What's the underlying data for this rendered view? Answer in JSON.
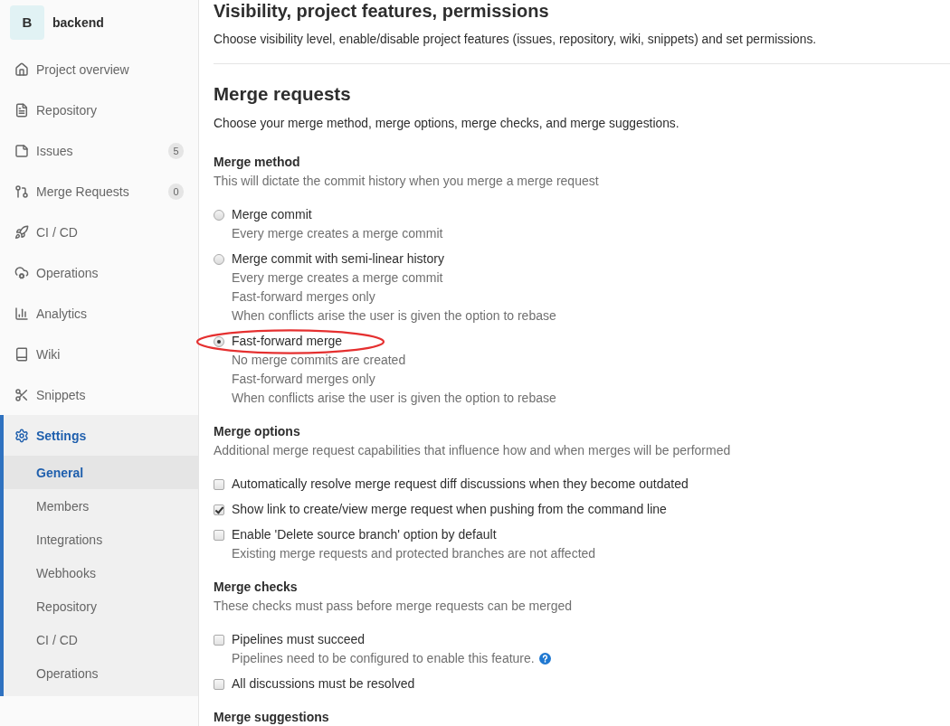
{
  "sidebar": {
    "project": {
      "avatar": "B",
      "name": "backend"
    },
    "items": [
      {
        "label": "Project overview",
        "selected": false
      },
      {
        "label": "Repository",
        "selected": false
      },
      {
        "label": "Issues",
        "badge": "5",
        "selected": false
      },
      {
        "label": "Merge Requests",
        "badge": "0",
        "selected": false
      },
      {
        "label": "CI / CD",
        "selected": false
      },
      {
        "label": "Operations",
        "selected": false
      },
      {
        "label": "Analytics",
        "selected": false
      },
      {
        "label": "Wiki",
        "selected": false
      },
      {
        "label": "Snippets",
        "selected": false
      },
      {
        "label": "Settings",
        "selected": true,
        "children": [
          {
            "label": "General",
            "selected": true
          },
          {
            "label": "Members",
            "selected": false
          },
          {
            "label": "Integrations",
            "selected": false
          },
          {
            "label": "Webhooks",
            "selected": false
          },
          {
            "label": "Repository",
            "selected": false
          },
          {
            "label": "CI / CD",
            "selected": false
          },
          {
            "label": "Operations",
            "selected": false
          }
        ]
      }
    ]
  },
  "page": {
    "visibility": {
      "title": "Visibility, project features, permissions",
      "description": "Choose visibility level, enable/disable project features (issues, repository, wiki, snippets) and set permissions."
    },
    "merge_requests": {
      "title": "Merge requests",
      "description": "Choose your merge method, merge options, merge checks, and merge suggestions.",
      "groups": [
        {
          "title": "Merge method",
          "description": "This will dictate the commit history when you merge a merge request",
          "options": [
            {
              "kind": "radio",
              "label": "Merge commit",
              "selected": false,
              "circled": false,
              "notes": [
                "Every merge creates a merge commit"
              ]
            },
            {
              "kind": "radio",
              "label": "Merge commit with semi-linear history",
              "selected": false,
              "circled": false,
              "notes": [
                "Every merge creates a merge commit",
                "Fast-forward merges only",
                "When conflicts arise the user is given the option to rebase"
              ]
            },
            {
              "kind": "radio",
              "label": "Fast-forward merge",
              "selected": true,
              "circled": true,
              "notes": [
                "No merge commits are created",
                "Fast-forward merges only",
                "When conflicts arise the user is given the option to rebase"
              ]
            }
          ]
        },
        {
          "title": "Merge options",
          "description": "Additional merge request capabilities that influence how and when merges will be performed",
          "options": [
            {
              "kind": "checkbox",
              "label": "Automatically resolve merge request diff discussions when they become outdated",
              "checked": false,
              "help_icon": false
            },
            {
              "kind": "checkbox",
              "label": "Show link to create/view merge request when pushing from the command line",
              "checked": true,
              "help_icon": false
            },
            {
              "kind": "checkbox",
              "label": "Enable 'Delete source branch' option by default",
              "checked": false,
              "help_icon": false,
              "notes": [
                "Existing merge requests and protected branches are not affected"
              ]
            }
          ]
        },
        {
          "title": "Merge checks",
          "description": "These checks must pass before merge requests can be merged",
          "options": [
            {
              "kind": "checkbox",
              "label": "Pipelines must succeed",
              "checked": false,
              "help_icon": true,
              "notes": [
                "Pipelines need to be configured to enable this feature."
              ]
            },
            {
              "kind": "checkbox",
              "label": "All discussions must be resolved",
              "checked": false,
              "help_icon": false
            }
          ]
        },
        {
          "title": "Merge suggestions"
        }
      ]
    }
  }
}
